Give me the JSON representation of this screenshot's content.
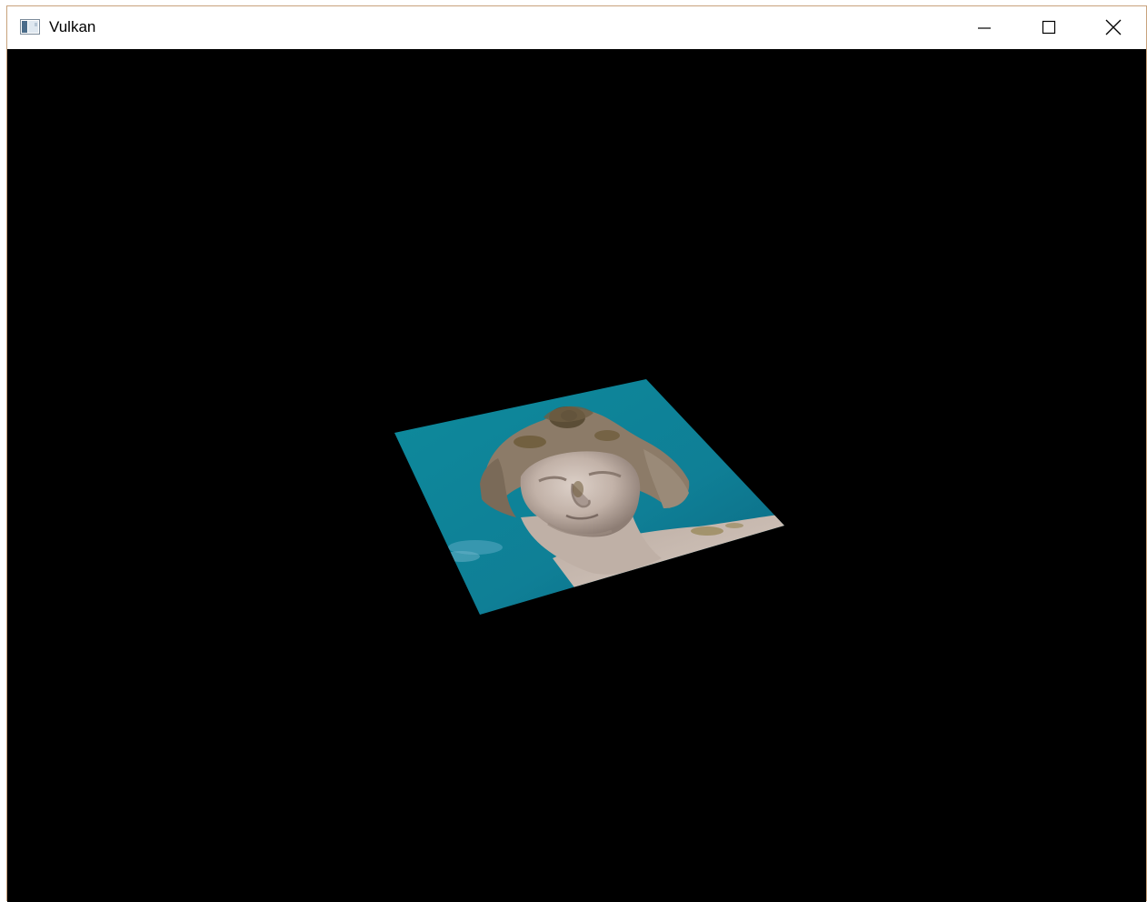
{
  "window": {
    "title": "Vulkan",
    "app_icon": "application-window-icon",
    "controls": {
      "minimize_icon": "minimize-icon",
      "maximize_icon": "maximize-icon",
      "close_icon": "close-icon"
    }
  },
  "viewport": {
    "background_color": "#000000",
    "content": "textured-quad",
    "texture_colors": {
      "sky": "#0f8aa0",
      "sky_dark": "#0a6e84",
      "stone": "#c8b8ae",
      "stone_shadow": "#8a7a70",
      "moss": "#6b5a36"
    }
  }
}
